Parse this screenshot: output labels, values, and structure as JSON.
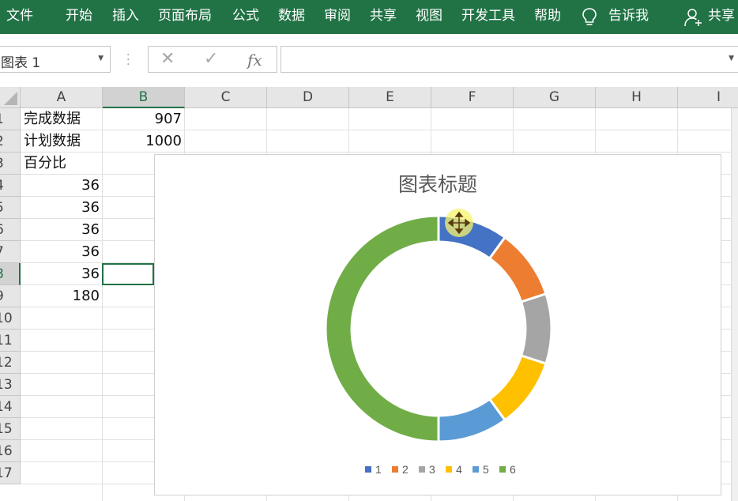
{
  "ribbon": {
    "tabs": [
      "文件",
      "开始",
      "插入",
      "页面布局",
      "公式",
      "数据",
      "审阅",
      "共享",
      "视图",
      "开发工具",
      "帮助"
    ],
    "tell_me": "告诉我",
    "share": "共享",
    "color": "#217346"
  },
  "formula_bar": {
    "name_box": "图表 1",
    "cancel_glyph": "✕",
    "enter_glyph": "✓",
    "fx_label": "fx",
    "formula": ""
  },
  "sheet": {
    "columns": [
      "A",
      "B",
      "C",
      "D",
      "E",
      "F",
      "G",
      "H",
      "I"
    ],
    "selected_column": "B",
    "rows": [
      "1",
      "2",
      "3",
      "4",
      "5",
      "6",
      "7",
      "8",
      "9",
      "10",
      "11",
      "12",
      "13",
      "14",
      "15",
      "16",
      "17"
    ],
    "selected_row": "8",
    "cells": {
      "A1": "完成数据",
      "B1": "907",
      "A2": "计划数据",
      "B2": "1000",
      "A3": "百分比",
      "A4": "36",
      "A5": "36",
      "A6": "36",
      "A7": "36",
      "A8": "36",
      "A9": "180"
    },
    "active_cell": "B8"
  },
  "chart_data": {
    "type": "pie",
    "subtype": "doughnut",
    "title": "图表标题",
    "categories": [
      "1",
      "2",
      "3",
      "4",
      "5",
      "6"
    ],
    "values": [
      36,
      36,
      36,
      36,
      36,
      180
    ],
    "colors": [
      "#4472C4",
      "#ED7D31",
      "#A5A5A5",
      "#FFC000",
      "#5B9BD5",
      "#70AD47"
    ],
    "legend_position": "bottom",
    "selected": true
  }
}
